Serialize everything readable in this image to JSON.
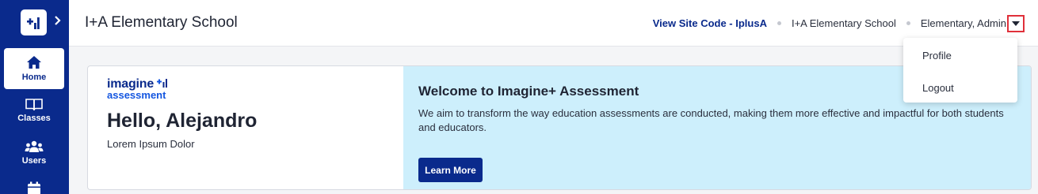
{
  "sidebar": {
    "items": [
      {
        "label": "Home",
        "icon": "home-icon"
      },
      {
        "label": "Classes",
        "icon": "book-icon"
      },
      {
        "label": "Users",
        "icon": "users-icon"
      },
      {
        "label": "",
        "icon": "calendar-icon"
      }
    ]
  },
  "header": {
    "title": "I+A Elementary School",
    "site_code": "View Site Code - IplusA",
    "school": "I+A Elementary School",
    "user": "Elementary, Admin"
  },
  "user_menu": {
    "items": [
      "Profile",
      "Logout"
    ]
  },
  "card": {
    "brand_line1": "imagine",
    "brand_line2": "assessment",
    "greeting": "Hello, Alejandro",
    "subtitle": "Lorem Ipsum Dolor",
    "welcome_title": "Welcome to Imagine+ Assessment",
    "welcome_text": "We aim to transform the way education assessments are conducted, making them more effective and impactful for both students and educators.",
    "button_label": "Learn More"
  },
  "colors": {
    "sidebar": "#0a2a8c",
    "accent": "#0a2a8c",
    "banner": "#cdeffc",
    "highlight": "#e0303a"
  }
}
